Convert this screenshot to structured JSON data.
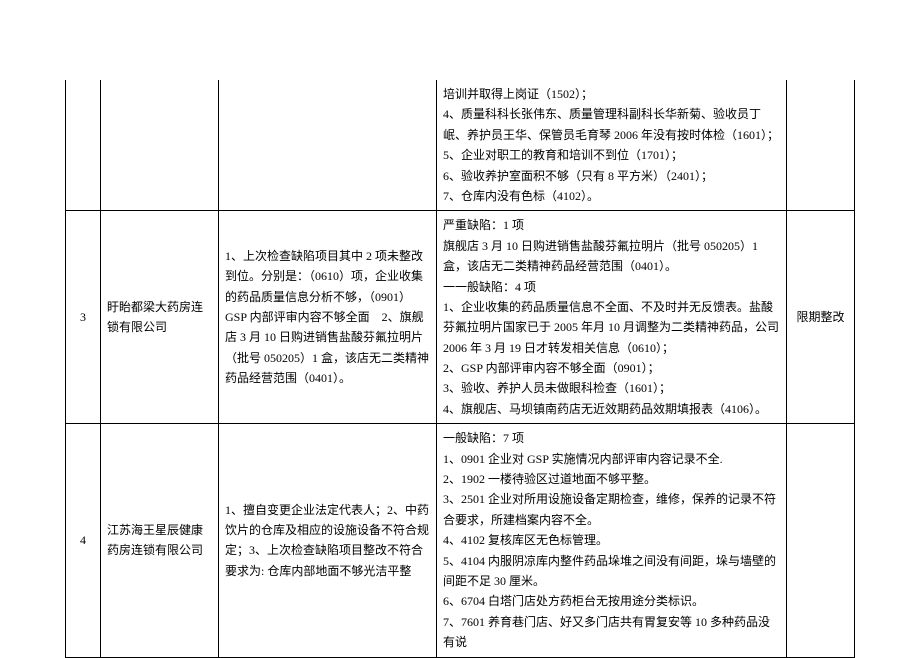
{
  "rows": [
    {
      "num": "",
      "company": "",
      "summary": "",
      "detail": "培训并取得上岗证（1502）；\n4、质量科科长张伟东、质量管理科副科长华新菊、验收员丁岷、养护员王华、保管员毛育琴 2006 年没有按时体检（1601）；\n5、企业对职工的教育和培训不到位（1701）；\n6、验收养护室面积不够（只有 8 平方米）（2401）；\n7、仓库内没有色标（4102）。",
      "action": ""
    },
    {
      "num": "3",
      "company": "盱眙都梁大药房连锁有限公司",
      "summary": "1、上次检查缺陷项目其中 2 项未整改到位。分别是：（0610）项，企业收集的药品质量信息分析不够，（0901）GSP 内部评审内容不够全面　2、旗舰店 3 月 10 日购进销售盐酸芬氟拉明片（批号 050205）1 盒，该店无二类精神药品经营范围（0401）。",
      "detail": "严重缺陷：1 项\n旗舰店 3 月 10 日购进销售盐酸芬氟拉明片（批号 050205）1 盒，该店无二类精神药品经营范围（0401）。\n一一般缺陷：4 项\n1、企业收集的药品质量信息不全面、不及时并无反馈表。盐酸芬氟拉明片国家已于 2005 年月 10 月调整为二类精神药品，公司 2006 年 3 月 19 日才转发相关信息（0610）；\n2、GSP 内部评审内容不够全面（0901）；\n3、验收、养护人员未做眼科检查（1601）；\n4、旗舰店、马坝镇南药店无近效期药品效期填报表（4106）。",
      "action": "限期整改"
    },
    {
      "num": "4",
      "company": "江苏海王星辰健康药房连锁有限公司",
      "summary": "1、擅自变更企业法定代表人；2、中药饮片的仓库及相应的设施设备不符合规定；3、上次检查缺陷项目整改不符合要求为: 仓库内部地面不够光洁平整",
      "detail": "一般缺陷：7 项\n1、0901 企业对 GSP 实施情况内部评审内容记录不全.\n2、1902 一楼待验区过道地面不够平整。\n3、2501 企业对所用设施设备定期检查，维修，保养的记录不符合要求，所建档案内容不全。\n4、4102 复核库区无色标管理。\n5、4104 内服阴凉库内整件药品垛堆之间没有间距，垛与墙壁的间距不足 30 厘米。\n6、6704 白塔门店处方药柜台无按用途分类标识。\n7、7601 养育巷门店、好又多门店共有胃复安等 10 多种药品没有说",
      "action": ""
    }
  ]
}
